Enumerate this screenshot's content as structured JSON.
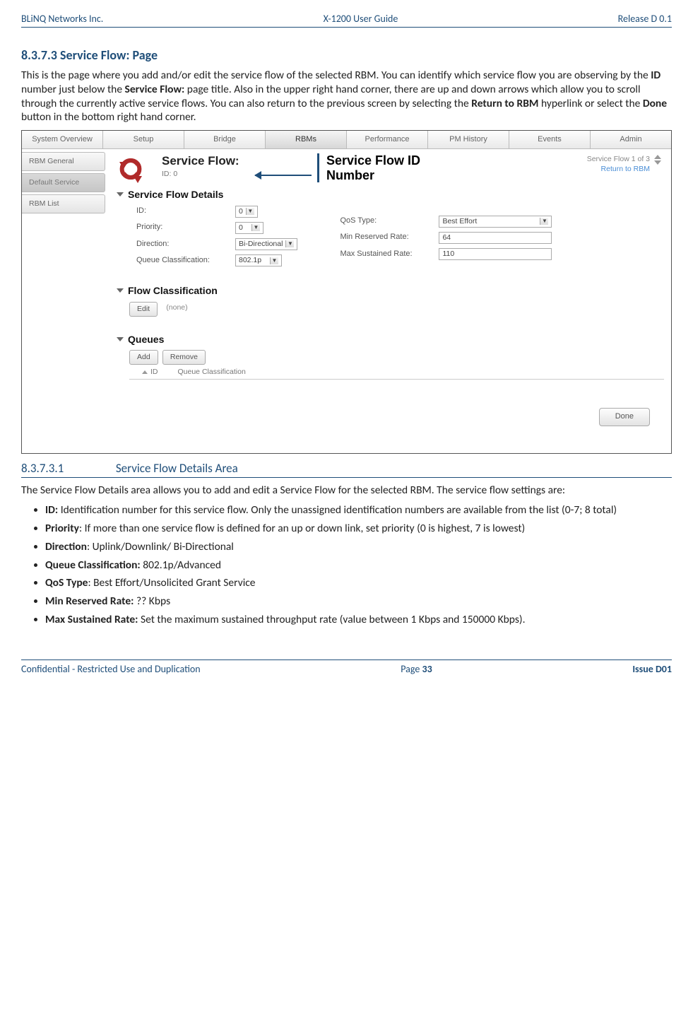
{
  "header": {
    "left": "BLiNQ Networks Inc.",
    "center": "X-1200 User Guide",
    "right": "Release D 0.1"
  },
  "footer": {
    "left": "Confidential - Restricted Use and Duplication",
    "page_label": "Page ",
    "page_num": "33",
    "right": "Issue D01"
  },
  "sec1": {
    "num": "8.3.7.3",
    "title": "Service Flow: Page",
    "para_a": "This is the page where you add and/or edit the service flow of the selected RBM. You can identify which service flow you are observing by the ",
    "b1": "ID",
    "para_b": " number just below the ",
    "b2": "Service Flow:",
    "para_c": " page title. Also in the upper right hand corner, there are up and down arrows which allow you to scroll through the currently active service flows. You can also return to the previous screen by selecting the ",
    "b3": "Return to RBM",
    "para_d": " hyperlink or select the ",
    "b4": "Done",
    "para_e": " button in the bottom right hand corner."
  },
  "annot": {
    "l1": "Service Flow ID",
    "l2": "Number"
  },
  "shot": {
    "tabs": [
      "System Overview",
      "Setup",
      "Bridge",
      "RBMs",
      "Performance",
      "PM History",
      "Events",
      "Admin"
    ],
    "active_tab_index": 3,
    "side": [
      "RBM General",
      "Default Service",
      "RBM List"
    ],
    "sf_title": "Service Flow:",
    "sf_id": "ID: 0",
    "tr1": "Service Flow 1 of 3",
    "tr2": "Return to RBM",
    "grp_details": "Service Flow Details",
    "left_fields": {
      "id_lbl": "ID:",
      "id_val": "0",
      "pri_lbl": "Priority:",
      "pri_val": "0",
      "dir_lbl": "Direction:",
      "dir_val": "Bi-Directional",
      "qc_lbl": "Queue Classification:",
      "qc_val": "802.1p"
    },
    "right_fields": {
      "qos_lbl": "QoS Type:",
      "qos_val": "Best Effort",
      "min_lbl": "Min Reserved Rate:",
      "min_val": "64",
      "max_lbl": "Max Sustained Rate:",
      "max_val": "110"
    },
    "grp_flow": "Flow Classification",
    "edit_btn": "Edit",
    "none": "(none)",
    "grp_queues": "Queues",
    "add_btn": "Add",
    "remove_btn": "Remove",
    "col_id": "ID",
    "col_qc": "Queue Classification",
    "done": "Done"
  },
  "sec2": {
    "num": "8.3.7.3.1",
    "title": "Service Flow Details Area",
    "para": "The Service Flow Details area allows you to add and edit a Service Flow for the selected RBM. The service flow settings are:",
    "items": [
      {
        "b": "ID:",
        "t": " Identification number for this service flow. Only the unassigned identification numbers are available from the list (0-7; 8 total)"
      },
      {
        "b": "Priority",
        "t": ": If more than one service flow is defined for an up or down link, set priority (0 is highest, 7 is lowest)"
      },
      {
        "b": "Direction",
        "t": ": Uplink/Downlink/ Bi-Directional"
      },
      {
        "b": "Queue Classification:",
        "t": " 802.1p/Advanced"
      },
      {
        "b": "QoS Type",
        "t": ": Best Effort/Unsolicited Grant Service"
      },
      {
        "b": "Min Reserved Rate:",
        "t": " ?? Kbps"
      },
      {
        "b": "Max Sustained Rate:",
        "t": " Set the maximum sustained throughput rate (value between 1 Kbps and 150000 Kbps)."
      }
    ]
  }
}
